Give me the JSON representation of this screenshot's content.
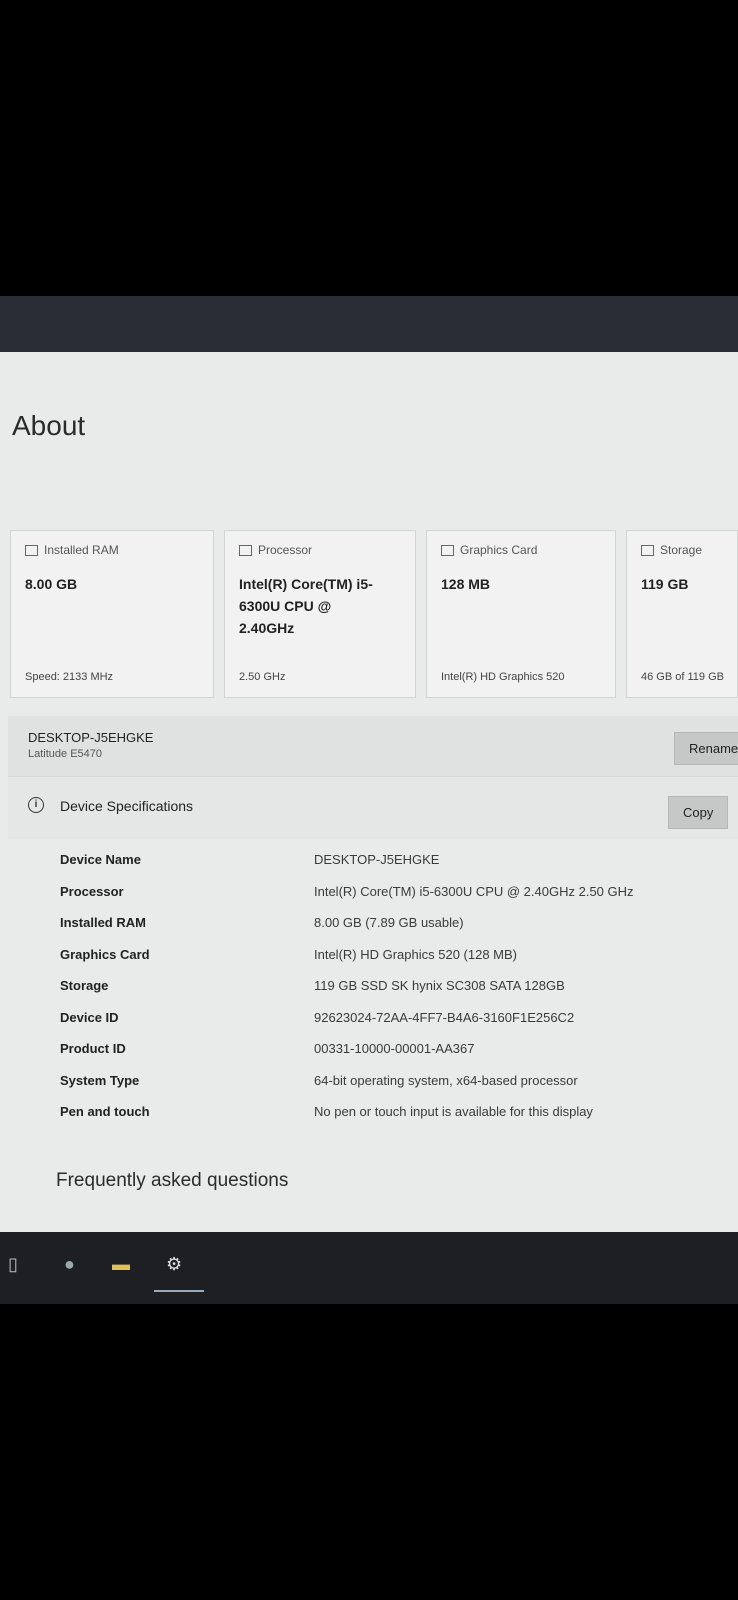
{
  "page": {
    "title": "About"
  },
  "cards": [
    {
      "icon": "ram-icon",
      "label": "Installed RAM",
      "value": "8.00 GB",
      "sub": "Speed: 2133 MHz"
    },
    {
      "icon": "processor-icon",
      "label": "Processor",
      "value": "Intel(R) Core(TM) i5-6300U CPU @ 2.40GHz",
      "sub": "2.50 GHz"
    },
    {
      "icon": "graphics-card-icon",
      "label": "Graphics Card",
      "value": "128 MB",
      "sub": "Intel(R) HD Graphics 520"
    },
    {
      "icon": "storage-icon",
      "label": "Storage",
      "value": "119 GB",
      "sub": "46 GB of 119 GB"
    }
  ],
  "device": {
    "name": "DESKTOP-J5EHGKE",
    "model": "Latitude E5470",
    "rename_label": "Rename"
  },
  "specs": {
    "title": "Device Specifications",
    "copy_label": "Copy",
    "rows": [
      {
        "key": "Device Name",
        "value": "DESKTOP-J5EHGKE"
      },
      {
        "key": "Processor",
        "value": "Intel(R) Core(TM) i5-6300U CPU @ 2.40GHz   2.50 GHz"
      },
      {
        "key": "Installed RAM",
        "value": "8.00 GB (7.89 GB usable)"
      },
      {
        "key": "Graphics Card",
        "value": "Intel(R) HD Graphics 520 (128 MB)"
      },
      {
        "key": "Storage",
        "value": "119 GB SSD SK hynix SC308 SATA 128GB"
      },
      {
        "key": "Device ID",
        "value": "92623024-72AA-4FF7-B4A6-3160F1E256C2"
      },
      {
        "key": "Product ID",
        "value": "00331-10000-00001-AA367"
      },
      {
        "key": "System Type",
        "value": "64-bit operating system, x64-based processor"
      },
      {
        "key": "Pen and touch",
        "value": "No pen or touch input is available for this display"
      }
    ]
  },
  "faq": {
    "title": "Frequently asked questions"
  },
  "taskbar": {
    "items": [
      "task-view-icon",
      "paint-icon",
      "file-explorer-icon",
      "settings-icon"
    ]
  }
}
